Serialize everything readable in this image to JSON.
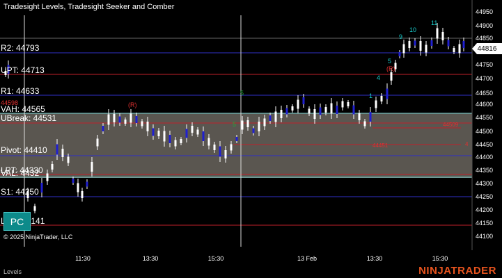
{
  "window": {
    "title": "Tradesight Levels, Tradesight Seeker and Comber"
  },
  "price_axis": {
    "ticks": [
      "44950",
      "44900",
      "44850",
      "44750",
      "44700",
      "44650",
      "44600",
      "44550",
      "44500",
      "44450",
      "44400",
      "44350",
      "44300",
      "44250",
      "44200",
      "44150",
      "44100"
    ]
  },
  "current_price": "44816",
  "time_axis": {
    "ticks": [
      "11:30",
      "13:30",
      "15:30",
      "13 Feb",
      "13:30",
      "15:30"
    ]
  },
  "levels": {
    "r2": "R2: 44793",
    "upt": "UPT: 44713",
    "r1": "R1: 44633",
    "red_small": "44598",
    "vah": "VAH: 44565",
    "ubreak": "UBreak: 44531",
    "pivot": "Pivot: 44410",
    "lpt": "LPT: 44330",
    "val": "VAL: 4432",
    "s1": "S1: 44250",
    "lbreak": "L",
    "lbreak_value": "44141"
  },
  "annotations": {
    "r_left": "(R)",
    "r_right": "(R)",
    "seq_5_left": "5",
    "seq_5_mid": "5",
    "seq_11": "11",
    "seq_10": "10",
    "seq_9": "9",
    "seq_5_right": "5",
    "seq_4": "4",
    "seq_1": "1",
    "red_level_1": "44509",
    "red_level_2": "44451",
    "red_tick": "4"
  },
  "pc_button": "PC",
  "copyright": "© 2025 NinjaTrader, LLC",
  "footer": {
    "indicator_name": "Levels"
  },
  "brand": "NINJATRADER",
  "colors": {
    "background": "#000000",
    "band": "#5a5650",
    "up_bar": "#ffffff",
    "down_bar": "#2020d0",
    "level_blue": "#2f2fc8",
    "level_red": "#c0202a",
    "brand": "#e8541e"
  }
}
